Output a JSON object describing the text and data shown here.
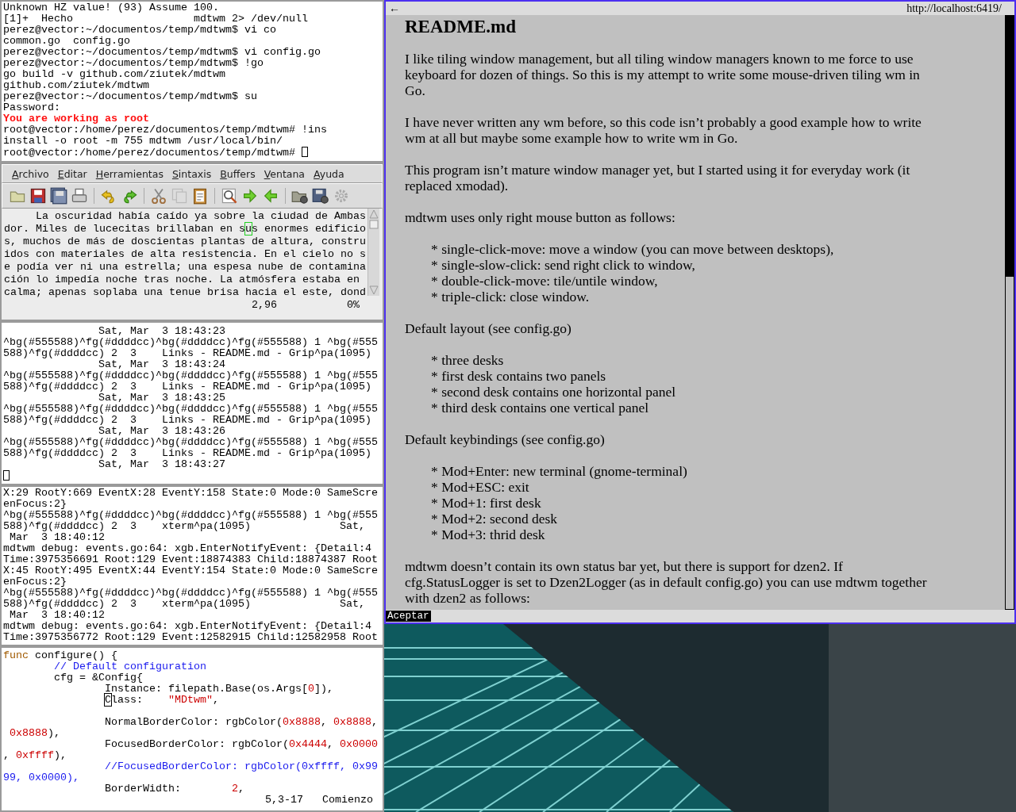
{
  "terminal_top": {
    "lines": [
      {
        "kind": "plain",
        "text": "Unknown HZ value! (93) Assume 100."
      },
      {
        "kind": "plain",
        "text": "[1]+  Hecho                   mdtwm 2> /dev/null"
      },
      {
        "kind": "plain",
        "text": "perez@vector:~/documentos/temp/mdtwm$ vi co"
      },
      {
        "kind": "plain",
        "text": "common.go  config.go"
      },
      {
        "kind": "plain",
        "text": "perez@vector:~/documentos/temp/mdtwm$ vi config.go"
      },
      {
        "kind": "plain",
        "text": "perez@vector:~/documentos/temp/mdtwm$ !go"
      },
      {
        "kind": "plain",
        "text": "go build -v github.com/ziutek/mdtwm"
      },
      {
        "kind": "plain",
        "text": "github.com/ziutek/mdtwm"
      },
      {
        "kind": "plain",
        "text": "perez@vector:~/documentos/temp/mdtwm$ su"
      },
      {
        "kind": "plain",
        "text": "Password:"
      },
      {
        "kind": "alert",
        "text": "You are working as root"
      },
      {
        "kind": "plain",
        "text": "root@vector:/home/perez/documentos/temp/mdtwm# !ins"
      },
      {
        "kind": "plain",
        "text": "install -o root -m 755 mdtwm /usr/local/bin/"
      },
      {
        "kind": "prompt",
        "text": "root@vector:/home/perez/documentos/temp/mdtwm# "
      }
    ]
  },
  "editor": {
    "menus": [
      "Archivo",
      "Editar",
      "Herramientas",
      "Sintaxis",
      "Buffers",
      "Ventana",
      "Ayuda"
    ],
    "lines": [
      [
        {
          "text": "     La oscuridad había caído ya sobre la ciudad de Ambas",
          "cursor": false
        }
      ],
      [
        {
          "text": "dor. Miles de lucecitas brillaban en s",
          "cursor": false
        },
        {
          "text": "u",
          "cursor": true
        },
        {
          "text": "s enormes edificio",
          "cursor": false
        }
      ],
      [
        {
          "text": "s, muchos de más de doscientas plantas de altura, constru",
          "cursor": false
        }
      ],
      [
        {
          "text": "idos con materiales de alta resistencia. En el cielo no s",
          "cursor": false
        }
      ],
      [
        {
          "text": "e podía ver ni una estrella; una espesa nube de contamina",
          "cursor": false
        }
      ],
      [
        {
          "text": "ción lo impedía noche tras noche. La atmósfera estaba en",
          "cursor": false
        }
      ],
      [
        {
          "text": "calma; apenas soplaba una tenue brisa hacia el este, dond",
          "cursor": false
        }
      ]
    ],
    "ruler": "2,96",
    "percent": "0%"
  },
  "terminal_status": {
    "lines": [
      {
        "kind": "plain",
        "text": "               Sat, Mar  3 18:43:23"
      },
      {
        "kind": "plain",
        "text": "^bg(#555588)^fg(#ddddcc)^bg(#ddddcc)^fg(#555588) 1 ^bg(#555"
      },
      {
        "kind": "plain",
        "text": "588)^fg(#ddddcc) 2  3    Links - README.md - Grip^pa(1095)"
      },
      {
        "kind": "plain",
        "text": "               Sat, Mar  3 18:43:24"
      },
      {
        "kind": "plain",
        "text": "^bg(#555588)^fg(#ddddcc)^bg(#ddddcc)^fg(#555588) 1 ^bg(#555"
      },
      {
        "kind": "plain",
        "text": "588)^fg(#ddddcc) 2  3    Links - README.md - Grip^pa(1095)"
      },
      {
        "kind": "plain",
        "text": "               Sat, Mar  3 18:43:25"
      },
      {
        "kind": "plain",
        "text": "^bg(#555588)^fg(#ddddcc)^bg(#ddddcc)^fg(#555588) 1 ^bg(#555"
      },
      {
        "kind": "plain",
        "text": "588)^fg(#ddddcc) 2  3    Links - README.md - Grip^pa(1095)"
      },
      {
        "kind": "plain",
        "text": "               Sat, Mar  3 18:43:26"
      },
      {
        "kind": "plain",
        "text": "^bg(#555588)^fg(#ddddcc)^bg(#ddddcc)^fg(#555588) 1 ^bg(#555"
      },
      {
        "kind": "plain",
        "text": "588)^fg(#ddddcc) 2  3    Links - README.md - Grip^pa(1095)"
      },
      {
        "kind": "plain",
        "text": "               Sat, Mar  3 18:43:27"
      },
      {
        "kind": "cursor"
      }
    ]
  },
  "terminal_debug": {
    "lines": [
      {
        "kind": "plain",
        "text": "X:29 RootY:669 EventX:28 EventY:158 State:0 Mode:0 SameScre"
      },
      {
        "kind": "plain",
        "text": "enFocus:2}"
      },
      {
        "kind": "plain",
        "text": "^bg(#555588)^fg(#ddddcc)^bg(#ddddcc)^fg(#555588) 1 ^bg(#555"
      },
      {
        "kind": "plain",
        "text": "588)^fg(#ddddcc) 2  3    xterm^pa(1095)              Sat,"
      },
      {
        "kind": "plain",
        "text": " Mar  3 18:40:12"
      },
      {
        "kind": "plain",
        "text": "mdtwm debug: events.go:64: xgb.EnterNotifyEvent: {Detail:4"
      },
      {
        "kind": "plain",
        "text": "Time:3975356691 Root:129 Event:18874383 Child:18874387 Root"
      },
      {
        "kind": "plain",
        "text": "X:45 RootY:495 EventX:44 EventY:154 State:0 Mode:0 SameScre"
      },
      {
        "kind": "plain",
        "text": "enFocus:2}"
      },
      {
        "kind": "plain",
        "text": "^bg(#555588)^fg(#ddddcc)^bg(#ddddcc)^fg(#555588) 1 ^bg(#555"
      },
      {
        "kind": "plain",
        "text": "588)^fg(#ddddcc) 2  3    xterm^pa(1095)              Sat,"
      },
      {
        "kind": "plain",
        "text": " Mar  3 18:40:12"
      },
      {
        "kind": "plain",
        "text": "mdtwm debug: events.go:64: xgb.EnterNotifyEvent: {Detail:4"
      },
      {
        "kind": "plain",
        "text": "Time:3975356772 Root:129 Event:12582915 Child:12582958 Root"
      }
    ]
  },
  "code_editor": {
    "lines": [
      {
        "kind": "code",
        "segments": [
          {
            "kind": "keyword",
            "text": "func"
          },
          {
            "kind": "plain",
            "text": " configure() {"
          }
        ]
      },
      {
        "kind": "code",
        "segments": [
          {
            "kind": "comment",
            "text": "        // Default configuration"
          }
        ]
      },
      {
        "kind": "code",
        "segments": [
          {
            "kind": "plain",
            "text": "        cfg = &Config{"
          }
        ]
      },
      {
        "kind": "code",
        "segments": [
          {
            "kind": "plain",
            "text": "                Instance: filepath.Base(os.Args["
          },
          {
            "kind": "literal",
            "text": "0"
          },
          {
            "kind": "plain",
            "text": "]),"
          }
        ]
      },
      {
        "kind": "nested",
        "segments": [
          {
            "kind": "cursor",
            "text": "C"
          },
          {
            "kind": "plain",
            "text": "lass:    "
          },
          {
            "kind": "literal",
            "text": "\"MDtwm\""
          },
          {
            "kind": "plain",
            "text": ","
          }
        ]
      },
      {
        "kind": "blank"
      },
      {
        "kind": "code",
        "segments": [
          {
            "kind": "plain",
            "text": "                NormalBorderColor: rgbColor("
          },
          {
            "kind": "literal",
            "text": "0x8888"
          },
          {
            "kind": "plain",
            "text": ", "
          },
          {
            "kind": "literal",
            "text": "0x8888"
          },
          {
            "kind": "plain",
            "text": ","
          }
        ]
      },
      {
        "kind": "code",
        "segments": [
          {
            "kind": "literal",
            "text": " 0x8888"
          },
          {
            "kind": "plain",
            "text": "),"
          }
        ]
      },
      {
        "kind": "code",
        "segments": [
          {
            "kind": "plain",
            "text": "                FocusedBorderColor: rgbColor("
          },
          {
            "kind": "literal",
            "text": "0x4444"
          },
          {
            "kind": "plain",
            "text": ", "
          },
          {
            "kind": "literal",
            "text": "0x0000"
          }
        ]
      },
      {
        "kind": "code",
        "segments": [
          {
            "kind": "plain",
            "text": ", "
          },
          {
            "kind": "literal",
            "text": "0xffff"
          },
          {
            "kind": "plain",
            "text": "),"
          }
        ]
      },
      {
        "kind": "code",
        "segments": [
          {
            "kind": "comment",
            "text": "                //FocusedBorderColor: rgbColor(0xffff, 0x99"
          }
        ]
      },
      {
        "kind": "code",
        "segments": [
          {
            "kind": "comment",
            "text": "99, 0x0000),"
          }
        ]
      },
      {
        "kind": "code",
        "segments": [
          {
            "kind": "plain",
            "text": "                BorderWidth:        "
          },
          {
            "kind": "literal",
            "text": "2"
          },
          {
            "kind": "plain",
            "text": ","
          }
        ]
      }
    ],
    "ruler": "5,3-17",
    "position": "Comienzo"
  },
  "browser": {
    "back": "←",
    "url": "http://localhost:6419/",
    "blocks": [
      {
        "kind": "heading",
        "text": "README.md"
      },
      {
        "kind": "paragraph",
        "lines": [
          "I like tiling window management, but all tiling window managers known to me force to use",
          "keyboard for dozen of things. So this is my attempt to write some mouse-driven tiling wm in",
          "Go."
        ]
      },
      {
        "kind": "paragraph",
        "lines": [
          "I have never written any wm before, so this code isn’t probably a good example how to write",
          "wm at all but maybe some example how to write wm in Go."
        ]
      },
      {
        "kind": "paragraph",
        "lines": [
          "This program isn’t mature window manager yet, but I started using it for everyday work (it",
          "replaced xmodad)."
        ]
      },
      {
        "kind": "paragraph",
        "lines": [
          "mdtwm uses only right mouse button as follows:"
        ]
      },
      {
        "kind": "list",
        "items": [
          "* single-click-move: move a window (you can move between desktops),",
          "* single-slow-click: send right click to window,",
          "* double-click-move: tile/untile window,",
          "* triple-click: close window."
        ]
      },
      {
        "kind": "paragraph",
        "lines": [
          "Default layout (see config.go)"
        ]
      },
      {
        "kind": "list",
        "items": [
          "* three desks",
          "* first desk contains two panels",
          "* second desk contains one horizontal panel",
          "* third desk contains one vertical panel"
        ]
      },
      {
        "kind": "paragraph",
        "lines": [
          "Default keybindings (see config.go)"
        ]
      },
      {
        "kind": "list",
        "items": [
          "* Mod+Enter: new terminal (gnome-terminal)",
          "* Mod+ESC: exit",
          "* Mod+1: first desk",
          "* Mod+2: second desk",
          "* Mod+3: thrid desk"
        ]
      },
      {
        "kind": "paragraph",
        "lines": [
          "mdtwm doesn’t contain its own status bar yet, but there is support for dzen2. If",
          "cfg.StatusLogger is set to Dzen2Logger (as in default config.go) you can use mdtwm together",
          "with dzen2 as follows:"
        ]
      }
    ],
    "button": "Aceptar"
  }
}
